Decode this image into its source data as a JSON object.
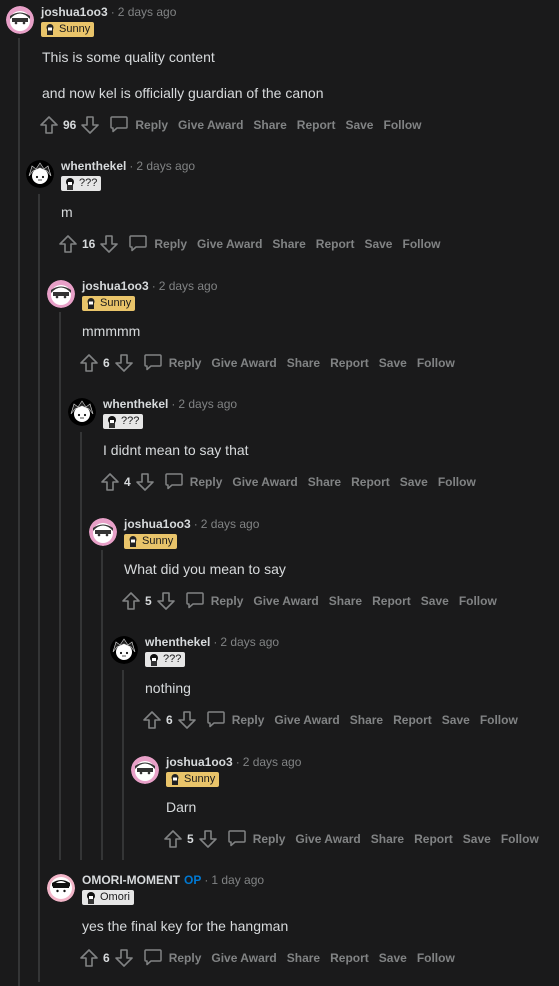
{
  "colors": {
    "background": "#1a1a1b",
    "sunny_flair": "#e9c46a",
    "op_badge": "#0079d3",
    "thread_line": "#343536"
  },
  "action_labels": {
    "reply": "Reply",
    "give_award": "Give Award",
    "share": "Share",
    "report": "Report",
    "save": "Save",
    "follow": "Follow"
  },
  "meta_separator": "·",
  "comments": [
    {
      "username": "joshua1oo3",
      "op_label": "",
      "time": "2 days ago",
      "flair": "Sunny",
      "avatar": "sunny-avatar",
      "body": [
        "This is some quality content",
        "and now kel is officially guardian of the canon"
      ],
      "votes": "96"
    },
    {
      "username": "whenthekel",
      "op_label": "",
      "time": "2 days ago",
      "flair": "???",
      "avatar": "kel-avatar",
      "body": [
        "m"
      ],
      "votes": "16"
    },
    {
      "username": "joshua1oo3",
      "op_label": "",
      "time": "2 days ago",
      "flair": "Sunny",
      "avatar": "sunny-avatar",
      "body": [
        "mmmmm"
      ],
      "votes": "6"
    },
    {
      "username": "whenthekel",
      "op_label": "",
      "time": "2 days ago",
      "flair": "???",
      "avatar": "kel-avatar",
      "body": [
        "I didnt mean to say that"
      ],
      "votes": "4"
    },
    {
      "username": "joshua1oo3",
      "op_label": "",
      "time": "2 days ago",
      "flair": "Sunny",
      "avatar": "sunny-avatar",
      "body": [
        "What did you mean to say"
      ],
      "votes": "5"
    },
    {
      "username": "whenthekel",
      "op_label": "",
      "time": "2 days ago",
      "flair": "???",
      "avatar": "kel-avatar",
      "body": [
        "nothing"
      ],
      "votes": "6"
    },
    {
      "username": "joshua1oo3",
      "op_label": "",
      "time": "2 days ago",
      "flair": "Sunny",
      "avatar": "sunny-avatar",
      "body": [
        "Darn"
      ],
      "votes": "5"
    },
    {
      "username": "OMORI-MOMENT",
      "op_label": "OP",
      "time": "1 day ago",
      "flair": "Omori",
      "avatar": "omori-avatar",
      "body": [
        "yes the final key for the hangman"
      ],
      "votes": "6"
    }
  ]
}
